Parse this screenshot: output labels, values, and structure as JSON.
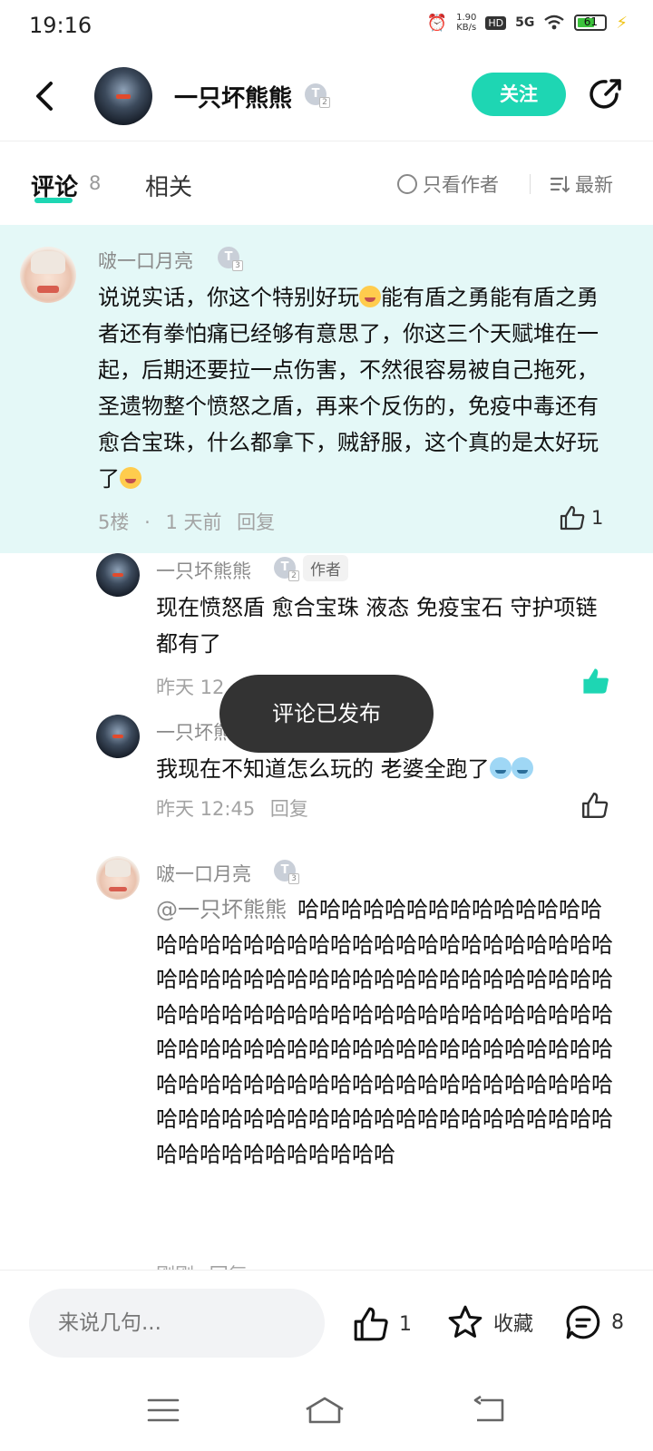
{
  "status_bar": {
    "time": "19:16",
    "speed_top": "1.90",
    "speed_bottom": "KB/s",
    "hd": "HD",
    "network": "5G",
    "battery": "61"
  },
  "header": {
    "username": "一只坏熊熊",
    "level": "T",
    "level_num": "2",
    "follow_label": "关注"
  },
  "tabs": {
    "comments_label": "评论",
    "comments_count": "8",
    "related_label": "相关",
    "only_author_label": "只看作者",
    "sort_label": "最新"
  },
  "main_comment": {
    "username": "啵一口月亮",
    "level": "T",
    "level_num": "3",
    "text_part1": "说说实话，你这个特别好玩",
    "text_part2": "能有盾之勇能有盾之勇者还有拳怕痛已经够有意思了，你这三个天赋堆在一起，后期还要拉一点伤害，不然很容易被自己拖死，圣遗物整个愤怒之盾，再来个反伤的，免疫中毒还有愈合宝珠，什么都拿下，贼舒服，这个真的是太好玩了",
    "floor": "5楼",
    "dot": "·",
    "time": "1 天前",
    "reply_label": "回复",
    "likes": "1"
  },
  "replies": [
    {
      "username": "一只坏熊熊",
      "level": "T",
      "level_num": "2",
      "author_badge": "作者",
      "text": "现在愤怒盾 愈合宝珠 液态 免疫宝石 守护项链都有了",
      "time": "昨天 12"
    },
    {
      "username": "一只坏熊",
      "text": "我现在不知道怎么玩的 老婆全跑了",
      "time": "昨天 12:45",
      "reply_label": "回复"
    },
    {
      "username": "啵一口月亮",
      "level": "T",
      "level_num": "3",
      "mention": "@一只坏熊熊",
      "text": "哈哈哈哈哈哈哈哈哈哈哈哈哈哈哈哈哈哈哈哈哈哈哈哈哈哈哈哈哈哈哈哈哈哈哈哈哈哈哈哈哈哈哈哈哈哈哈哈哈哈哈哈哈哈哈哈哈哈哈哈哈哈哈哈哈哈哈哈哈哈哈哈哈哈哈哈哈哈哈哈哈哈哈哈哈哈哈哈哈哈哈哈哈哈哈哈哈哈哈哈哈哈哈哈哈哈哈哈哈哈哈哈哈哈哈哈哈哈哈哈哈哈哈哈哈哈哈哈哈哈哈哈哈哈哈哈哈哈哈哈哈哈哈哈哈哈哈哈哈哈哈",
      "time": "刚刚",
      "reply_label": "回复"
    }
  ],
  "toast": "评论已发布",
  "bottom_bar": {
    "input_placeholder": "来说几句...",
    "likes": "1",
    "favorite_label": "收藏",
    "comments": "8"
  },
  "colors": {
    "accent": "#1ed6b3",
    "highlight_bg": "#e4f8f7",
    "liked": "#1ed6b3"
  }
}
